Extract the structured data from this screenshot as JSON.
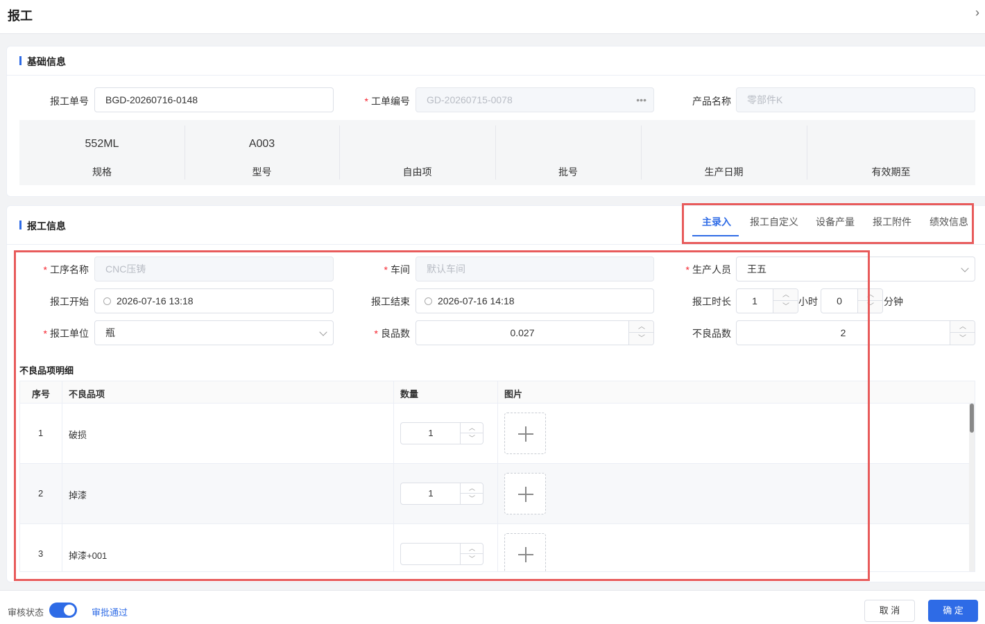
{
  "window": {
    "title": "报工",
    "close_icon": "close-icon"
  },
  "basic": {
    "section_title": "基础信息",
    "report_no_label": "报工单号",
    "report_no_value": "BGD-20260716-0148",
    "work_order_label": "工单编号",
    "work_order_value": "GD-20260715-0078",
    "product_label": "产品名称",
    "product_value": "零部件K",
    "strip": [
      {
        "value": "552ML",
        "key": "规格"
      },
      {
        "value": "A003",
        "key": "型号"
      },
      {
        "value": "",
        "key": "自由项"
      },
      {
        "value": "",
        "key": "批号"
      },
      {
        "value": "",
        "key": "生产日期"
      },
      {
        "value": "",
        "key": "有效期至"
      }
    ]
  },
  "report": {
    "section_title": "报工信息",
    "tabs": [
      "主录入",
      "报工自定义",
      "设备产量",
      "报工附件",
      "绩效信息"
    ],
    "active_tab": "主录入",
    "process_label": "工序名称",
    "process_placeholder": "CNC压铸",
    "workshop_label": "车间",
    "workshop_placeholder": "默认车间",
    "worker_label": "生产人员",
    "worker_value": "王五",
    "start_label": "报工开始",
    "start_value": "2026-07-16 13:18",
    "end_label": "报工结束",
    "end_value": "2026-07-16 14:18",
    "duration_label": "报工时长",
    "hours_value": "1",
    "hours_unit": "小时",
    "minutes_value": "0",
    "minutes_unit": "分钟",
    "unit_label": "报工单位",
    "unit_value": "瓶",
    "good_label": "良品数",
    "good_value": "0.027",
    "bad_label": "不良品数",
    "bad_value": "2"
  },
  "defects": {
    "title": "不良品项明细",
    "headers": [
      "序号",
      "不良品项",
      "数量",
      "图片"
    ],
    "rows": [
      {
        "no": "1",
        "item": "破损",
        "qty": "1"
      },
      {
        "no": "2",
        "item": "掉漆",
        "qty": "1"
      },
      {
        "no": "3",
        "item": "掉漆+001",
        "qty": ""
      }
    ]
  },
  "footer": {
    "status_label": "审核状态",
    "toggle_on": true,
    "approve_text": "审批通过",
    "cancel_label": "取 消",
    "ok_label": "确 定"
  },
  "colors": {
    "accent": "#2e6be6",
    "highlight_box": "#e85b5b",
    "required": "#f5222d"
  }
}
